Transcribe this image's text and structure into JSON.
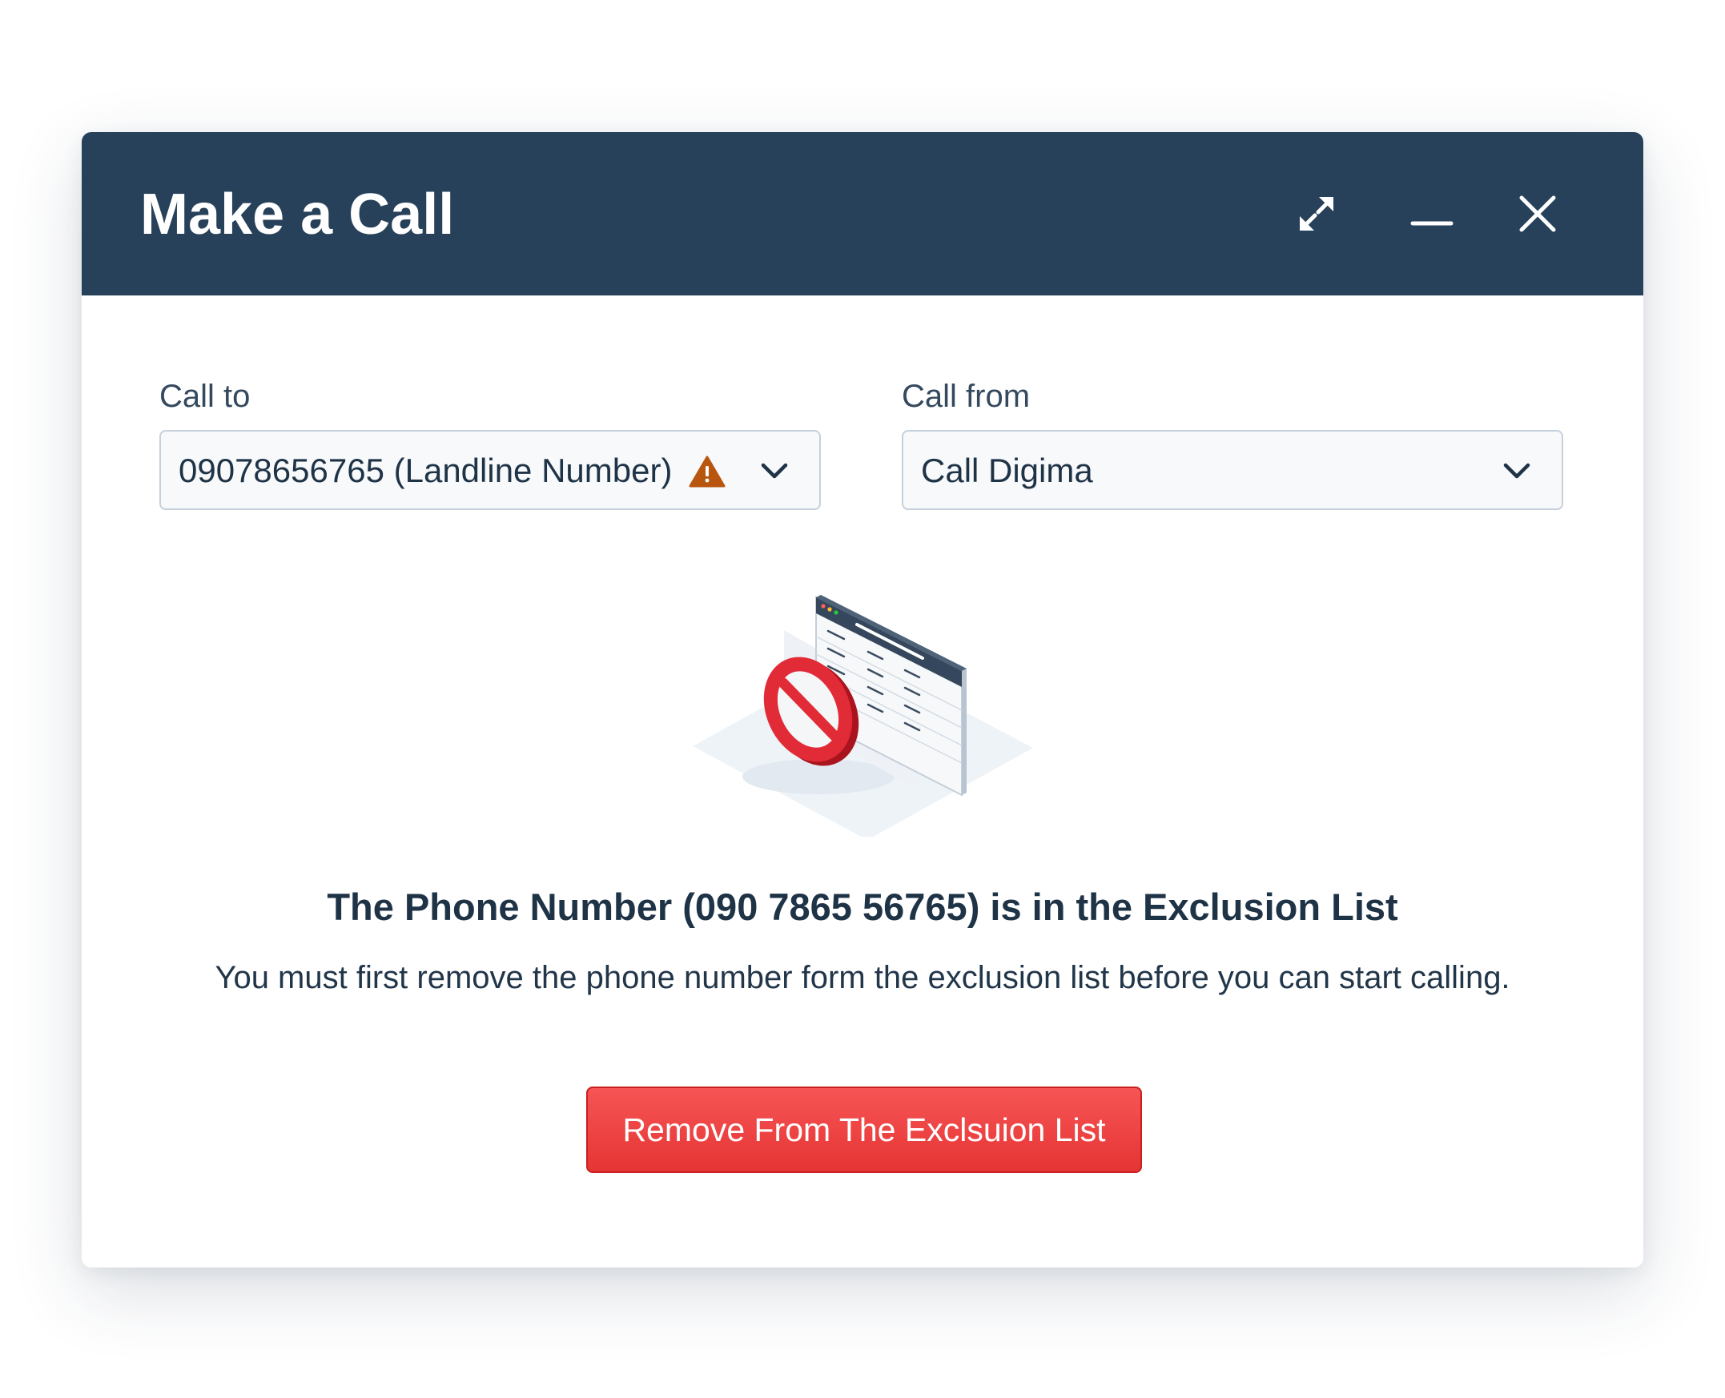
{
  "dialog": {
    "title": "Make a Call",
    "controls": {
      "expand_icon": "expand-icon",
      "minimize_icon": "minimize-icon",
      "close_icon": "close-icon"
    }
  },
  "form": {
    "call_to": {
      "label": "Call to",
      "value": "09078656765 (Landline Number)",
      "warning_icon": "warning-icon"
    },
    "call_from": {
      "label": "Call from",
      "value": "Call Digima"
    }
  },
  "message": {
    "headline": "The Phone Number (090 7865 56765) is in the Exclusion List",
    "body": "You must first remove the phone number form the exclusion list before you can start calling."
  },
  "actions": {
    "remove_label": "Remove From The Exclsuion List"
  },
  "colors": {
    "header": "#27415a",
    "danger": "#e63434",
    "warning": "#b8560f"
  }
}
